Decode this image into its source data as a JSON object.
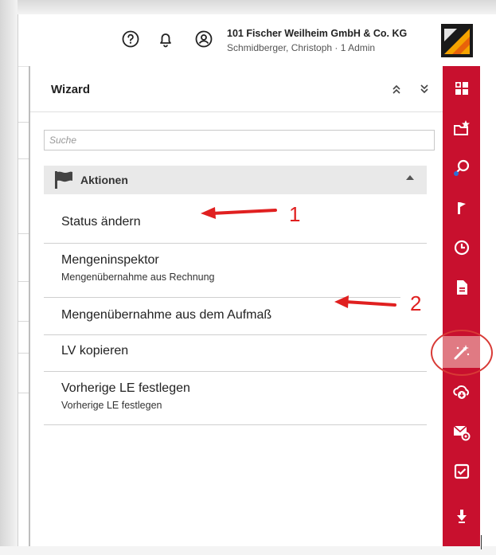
{
  "header": {
    "company": "101 Fischer Weilheim GmbH & Co. KG",
    "user": "Schmidberger, Christoph · 1 Admin"
  },
  "wizard": {
    "title": "Wizard",
    "search_placeholder": "Suche",
    "section_label": "Aktionen",
    "items": [
      {
        "title": "Status ändern",
        "subtitle": ""
      },
      {
        "title": "Mengeninspektor",
        "subtitle": "Mengenübernahme aus Rechnung"
      },
      {
        "title": "Mengenübernahme aus dem Aufmaß",
        "subtitle": ""
      },
      {
        "title": "LV kopieren",
        "subtitle": ""
      },
      {
        "title": "Vorherige LE festlegen",
        "subtitle": "Vorherige LE festlegen"
      }
    ]
  },
  "annotations": {
    "one": "1",
    "two": "2"
  },
  "rail": {
    "icons": [
      "grid-icon",
      "star-folder-icon",
      "search-location-icon",
      "flag-icon",
      "clock-icon",
      "document-icon",
      "magic-wand-icon",
      "cloud-download-icon",
      "mail-gear-icon",
      "checkbox-icon",
      "download-icon"
    ],
    "active": "magic-wand-icon",
    "color": "#c8102e",
    "active_color": "#e07a83"
  }
}
